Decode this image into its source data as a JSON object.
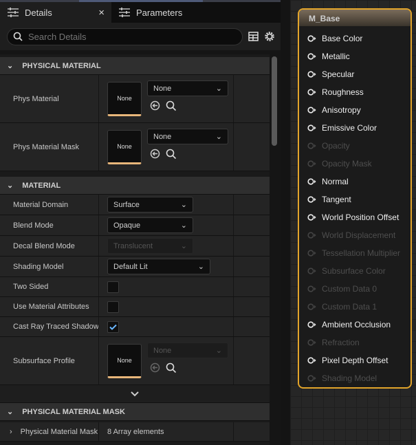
{
  "tabs": [
    {
      "label": "Details",
      "active": true,
      "icon": "sliders-icon",
      "close": "×"
    },
    {
      "label": "Parameters",
      "icon": "sliders-icon"
    }
  ],
  "search": {
    "placeholder": "Search Details"
  },
  "sections": {
    "physical_material": "PHYSICAL MATERIAL",
    "material": "MATERIAL",
    "physical_material_mask": "PHYSICAL MATERIAL MASK"
  },
  "phys_rows": [
    {
      "label": "Phys Material",
      "thumb": "None",
      "value": "None"
    },
    {
      "label": "Phys Material Mask",
      "thumb": "None",
      "value": "None"
    }
  ],
  "material_rows": {
    "domain": {
      "label": "Material Domain",
      "value": "Surface"
    },
    "blend": {
      "label": "Blend Mode",
      "value": "Opaque"
    },
    "decal": {
      "label": "Decal Blend Mode",
      "value": "Translucent",
      "disabled": true
    },
    "shading": {
      "label": "Shading Model",
      "value": "Default Lit"
    },
    "two_sided": {
      "label": "Two Sided",
      "checked": false
    },
    "use_attr": {
      "label": "Use Material Attributes",
      "checked": false
    },
    "cast_rt": {
      "label": "Cast Ray Traced Shadows",
      "checked": true
    },
    "subsurface": {
      "label": "Subsurface Profile",
      "thumb": "None",
      "value": "None",
      "disabled": true
    }
  },
  "mask_row": {
    "label": "Physical Material Mask",
    "value": "8 Array elements"
  },
  "colors": {
    "accent": "#e3a52a",
    "check": "#6ab7ff",
    "thumb_underline": "#e8b67a"
  },
  "node": {
    "title": "M_Base",
    "pins": [
      {
        "label": "Base Color",
        "active": true
      },
      {
        "label": "Metallic",
        "active": true
      },
      {
        "label": "Specular",
        "active": true
      },
      {
        "label": "Roughness",
        "active": true
      },
      {
        "label": "Anisotropy",
        "active": true
      },
      {
        "label": "Emissive Color",
        "active": true
      },
      {
        "label": "Opacity",
        "active": false
      },
      {
        "label": "Opacity Mask",
        "active": false
      },
      {
        "label": "Normal",
        "active": true
      },
      {
        "label": "Tangent",
        "active": true
      },
      {
        "label": "World Position Offset",
        "active": true
      },
      {
        "label": "World Displacement",
        "active": false
      },
      {
        "label": "Tessellation Multiplier",
        "active": false
      },
      {
        "label": "Subsurface Color",
        "active": false
      },
      {
        "label": "Custom Data 0",
        "active": false
      },
      {
        "label": "Custom Data 1",
        "active": false
      },
      {
        "label": "Ambient Occlusion",
        "active": true
      },
      {
        "label": "Refraction",
        "active": false
      },
      {
        "label": "Pixel Depth Offset",
        "active": true
      },
      {
        "label": "Shading Model",
        "active": false
      }
    ]
  }
}
